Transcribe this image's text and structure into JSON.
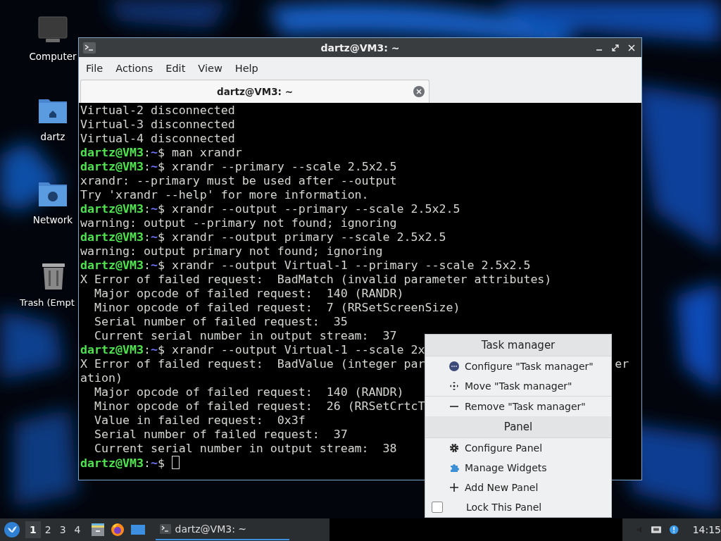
{
  "desktop_icons": [
    {
      "label": "Computer"
    },
    {
      "label": "dartz"
    },
    {
      "label": "Network"
    },
    {
      "label": "Trash (Empt"
    }
  ],
  "window": {
    "title": "dartz@VM3: ~",
    "menu": [
      "File",
      "Actions",
      "Edit",
      "View",
      "Help"
    ],
    "tab": {
      "label": "dartz@VM3: ~",
      "selected": true
    }
  },
  "terminal": {
    "lines": [
      {
        "kind": "output",
        "text": "Virtual-2 disconnected"
      },
      {
        "kind": "output",
        "text": "Virtual-3 disconnected"
      },
      {
        "kind": "output",
        "text": "Virtual-4 disconnected"
      },
      {
        "kind": "prompt",
        "user": "dartz@VM3",
        "colon": ":",
        "path": "~",
        "command": "$ man xrandr"
      },
      {
        "kind": "prompt",
        "user": "dartz@VM3",
        "colon": ":",
        "path": "~",
        "command": "$ xrandr --primary --scale 2.5x2.5"
      },
      {
        "kind": "output",
        "text": "xrandr: --primary must be used after --output"
      },
      {
        "kind": "output",
        "text": "Try 'xrandr --help' for more information."
      },
      {
        "kind": "prompt",
        "user": "dartz@VM3",
        "colon": ":",
        "path": "~",
        "command": "$ xrandr --output --primary --scale 2.5x2.5"
      },
      {
        "kind": "output",
        "text": "warning: output --primary not found; ignoring"
      },
      {
        "kind": "prompt",
        "user": "dartz@VM3",
        "colon": ":",
        "path": "~",
        "command": "$ xrandr --output primary --scale 2.5x2.5"
      },
      {
        "kind": "output",
        "text": "warning: output primary not found; ignoring"
      },
      {
        "kind": "prompt",
        "user": "dartz@VM3",
        "colon": ":",
        "path": "~",
        "command": "$ xrandr --output Virtual-1 --primary --scale 2.5x2.5"
      },
      {
        "kind": "output",
        "text": "X Error of failed request:  BadMatch (invalid parameter attributes)"
      },
      {
        "kind": "output",
        "text": "  Major opcode of failed request:  140 (RANDR)"
      },
      {
        "kind": "output",
        "text": "  Minor opcode of failed request:  7 (RRSetScreenSize)"
      },
      {
        "kind": "output",
        "text": "  Serial number of failed request:  35"
      },
      {
        "kind": "output",
        "text": "  Current serial number in output stream:  37"
      },
      {
        "kind": "prompt",
        "user": "dartz@VM3",
        "colon": ":",
        "path": "~",
        "command": "$ xrandr --output Virtual-1 --scale 2x"
      },
      {
        "kind": "output",
        "text": "X Error of failed request:  BadValue (integer par",
        "tail": "er"
      },
      {
        "kind": "output",
        "text": "ation)"
      },
      {
        "kind": "output",
        "text": "  Major opcode of failed request:  140 (RANDR)"
      },
      {
        "kind": "output",
        "text": "  Minor opcode of failed request:  26 (RRSetCrtcT"
      },
      {
        "kind": "output",
        "text": "  Value in failed request:  0x3f"
      },
      {
        "kind": "output",
        "text": "  Serial number of failed request:  37"
      },
      {
        "kind": "output",
        "text": "  Current serial number in output stream:  38"
      },
      {
        "kind": "prompt",
        "user": "dartz@VM3",
        "colon": ":",
        "path": "~",
        "command": "$ ",
        "cursor": true
      }
    ]
  },
  "context_menu": {
    "sections": [
      {
        "title": "Task manager",
        "items": [
          {
            "kind": "action",
            "label": "Configure \"Task manager\""
          },
          {
            "kind": "action",
            "label": "Move \"Task manager\""
          },
          {
            "kind": "action",
            "label": "Remove \"Task manager\""
          }
        ]
      },
      {
        "title": "Panel",
        "items": [
          {
            "kind": "action",
            "label": "Configure Panel"
          },
          {
            "kind": "action",
            "label": "Manage Widgets"
          },
          {
            "kind": "action",
            "label": "Add New Panel"
          },
          {
            "kind": "checkbox",
            "label": "Lock This Panel",
            "checked": false
          }
        ]
      }
    ]
  },
  "taskbar": {
    "desktops": [
      {
        "label": "1",
        "selected": true
      },
      {
        "label": "2",
        "selected": false
      },
      {
        "label": "3",
        "selected": false
      },
      {
        "label": "4",
        "selected": false
      }
    ],
    "tasks": [
      {
        "label": "dartz@VM3: ~",
        "selected": true
      }
    ],
    "clock": "14:15"
  }
}
